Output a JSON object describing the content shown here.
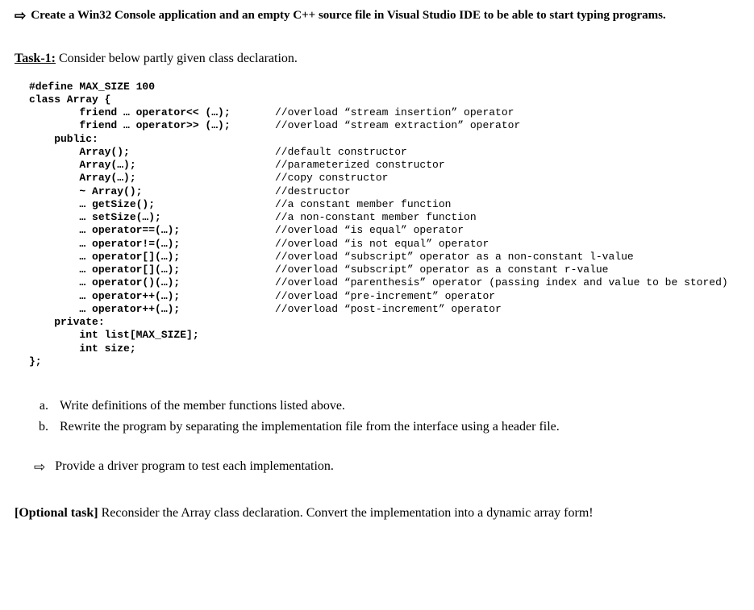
{
  "top_instruction": "Create a Win32 Console application and an empty C++ source file in Visual Studio IDE to be able to start typing programs.",
  "task_label": "Task-1:",
  "task_desc": " Consider below partly given class declaration.",
  "code": {
    "lines": [
      {
        "left": "#define MAX_SIZE 100",
        "bold": true,
        "comment": ""
      },
      {
        "left": "class Array {",
        "bold": true,
        "comment": ""
      },
      {
        "left": "        friend … operator<< (…);",
        "bold": true,
        "comment": "//overload “stream insertion” operator"
      },
      {
        "left": "        friend … operator>> (…);",
        "bold": true,
        "comment": "//overload “stream extraction” operator"
      },
      {
        "left": "    public:",
        "bold": true,
        "comment": ""
      },
      {
        "left": "        Array();",
        "bold": true,
        "comment": "//default constructor"
      },
      {
        "left": "        Array(…);",
        "bold": true,
        "comment": "//parameterized constructor"
      },
      {
        "left": "        Array(…);",
        "bold": true,
        "comment": "//copy constructor"
      },
      {
        "left": "        ~ Array();",
        "bold": true,
        "comment": "//destructor"
      },
      {
        "left": "        … getSize();",
        "bold": true,
        "comment": "//a constant member function"
      },
      {
        "left": "        … setSize(…);",
        "bold": true,
        "comment": "//a non-constant member function"
      },
      {
        "left": "        … operator==(…);",
        "bold": true,
        "comment": "//overload “is equal” operator"
      },
      {
        "left": "        … operator!=(…);",
        "bold": true,
        "comment": "//overload “is not equal” operator"
      },
      {
        "left": "        … operator[](…);",
        "bold": true,
        "comment": "//overload “subscript” operator as a non-constant l-value"
      },
      {
        "left": "        … operator[](…);",
        "bold": true,
        "comment": "//overload “subscript” operator as a constant r-value"
      },
      {
        "left": "        … operator()(…);",
        "bold": true,
        "comment": "//overload “parenthesis” operator (passing index and value to be stored)"
      },
      {
        "left": "        … operator++(…);",
        "bold": true,
        "comment": "//overload “pre-increment” operator"
      },
      {
        "left": "        … operator++(…);",
        "bold": true,
        "comment": "//overload “post-increment” operator"
      },
      {
        "left": "    private:",
        "bold": true,
        "comment": ""
      },
      {
        "left": "        int list[MAX_SIZE];",
        "bold": true,
        "comment": ""
      },
      {
        "left": "        int size;",
        "bold": true,
        "comment": ""
      },
      {
        "left": "};",
        "bold": true,
        "comment": ""
      }
    ]
  },
  "list_items": [
    {
      "marker": "a.",
      "text": "Write definitions of the member functions listed above."
    },
    {
      "marker": "b.",
      "text": "Rewrite the program by separating the implementation file from the interface using a header file."
    }
  ],
  "driver_text": "Provide a driver program to test each implementation.",
  "optional_label": "[Optional task]",
  "optional_text": " Reconsider the Array class declaration. Convert the implementation into a dynamic array form!",
  "arrow_glyph": "⇨"
}
